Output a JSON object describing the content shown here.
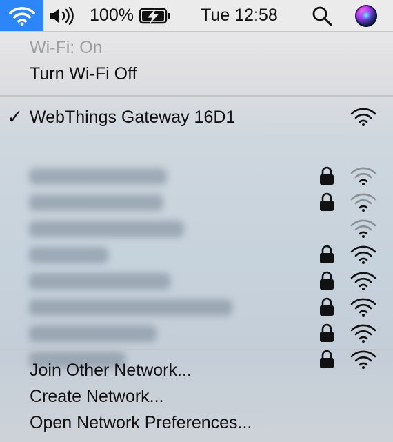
{
  "menubar": {
    "wifi_icon": "wifi-icon",
    "volume_icon": "speaker-volume-icon",
    "battery_percent": "100%",
    "battery_icon": "battery-charging-icon",
    "clock": "Tue 12:58",
    "search_icon": "magnifying-glass-icon",
    "siri_icon": "siri-icon",
    "accent_color": "#2d86f8"
  },
  "wifi_menu": {
    "status": "Wi-Fi: On",
    "toggle_label": "Turn Wi-Fi Off",
    "connected_network": {
      "checkmark": "✓",
      "name": "WebThings Gateway 16D1",
      "secured": false,
      "signal": "full"
    },
    "networks": [
      {
        "name_blurred": true,
        "secured": true,
        "signal": "weak"
      },
      {
        "name_blurred": true,
        "secured": true,
        "signal": "weak"
      },
      {
        "name_blurred": true,
        "secured": false,
        "signal": "weak"
      },
      {
        "name_blurred": true,
        "secured": true,
        "signal": "full"
      },
      {
        "name_blurred": true,
        "secured": true,
        "signal": "full"
      },
      {
        "name_blurred": true,
        "secured": true,
        "signal": "full"
      },
      {
        "name_blurred": true,
        "secured": true,
        "signal": "full"
      },
      {
        "name_blurred": true,
        "secured": true,
        "signal": "full"
      }
    ],
    "actions": {
      "join_other": "Join Other Network...",
      "create_network": "Create Network...",
      "open_preferences": "Open Network Preferences..."
    }
  }
}
